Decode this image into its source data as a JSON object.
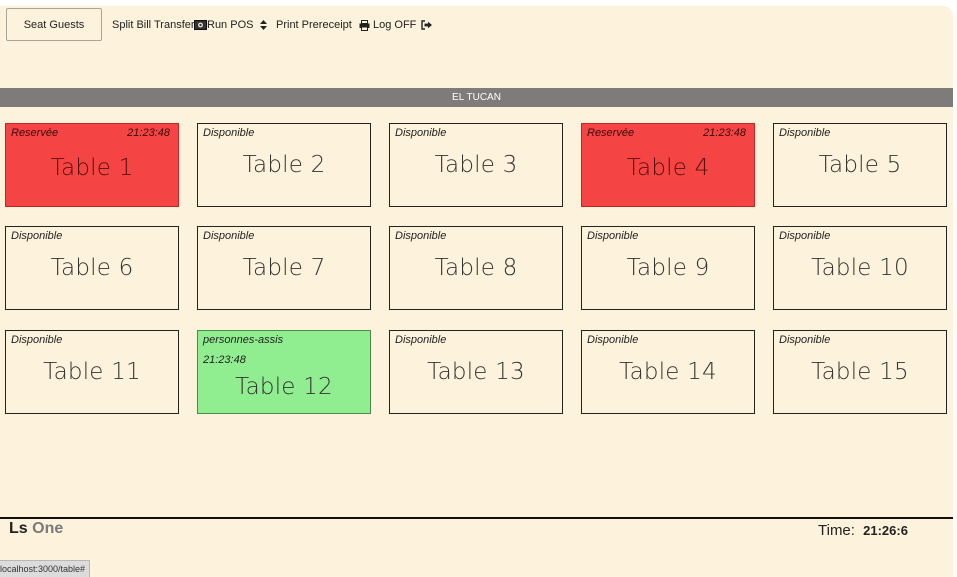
{
  "toolbar": {
    "seat_guests": "Seat Guests",
    "split_bill": "Split Bill",
    "transfer": "Transfer",
    "run_pos": "Run POS",
    "print_prereceipt": "Print Prereceipt",
    "log_off": "Log OFF"
  },
  "banner": {
    "title": "EL TUCAN"
  },
  "tables": [
    {
      "name": "Table 1",
      "status": "Reservée",
      "time": "21:23:48"
    },
    {
      "name": "Table 2",
      "status": "Disponible"
    },
    {
      "name": "Table 3",
      "status": "Disponible"
    },
    {
      "name": "Table 4",
      "status": "Reservée",
      "time": "21:23:48"
    },
    {
      "name": "Table 5",
      "status": "Disponible"
    },
    {
      "name": "Table 6",
      "status": "Disponible"
    },
    {
      "name": "Table 7",
      "status": "Disponible"
    },
    {
      "name": "Table 8",
      "status": "Disponible"
    },
    {
      "name": "Table 9",
      "status": "Disponible"
    },
    {
      "name": "Table 10",
      "status": "Disponible"
    },
    {
      "name": "Table 11",
      "status": "Disponible"
    },
    {
      "name": "Table 12",
      "status": "personnes-assis",
      "time": "21:23:48"
    },
    {
      "name": "Table 13",
      "status": "Disponible"
    },
    {
      "name": "Table 14",
      "status": "Disponible"
    },
    {
      "name": "Table 15",
      "status": "Disponible"
    }
  ],
  "footer": {
    "brand_ls": "Ls",
    "brand_one": "One",
    "time_label": "Time:",
    "time_value": "21:26:6"
  },
  "status_bar": {
    "url": "localhost:3000/table#"
  },
  "colors": {
    "background": "#fdf3dc",
    "reserved": "#f44444",
    "seated": "#90ee90",
    "banner": "#7f7b7b"
  },
  "icons": {
    "run_pos": "money-icon",
    "run_pos_sort": "sort-icon",
    "print": "printer-icon",
    "log_off": "sign-out-icon"
  }
}
